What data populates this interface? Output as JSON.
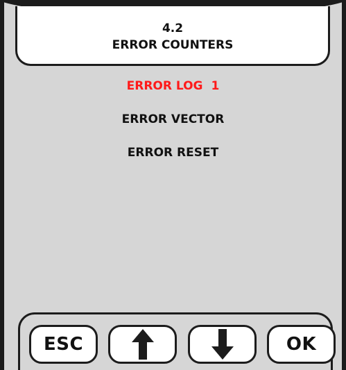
{
  "header": {
    "section_number": "4.2",
    "title": "ERROR COUNTERS"
  },
  "menu": {
    "items": [
      {
        "label": "ERROR LOG",
        "count": "1",
        "selected": true
      },
      {
        "label": "ERROR VECTOR",
        "count": "",
        "selected": false
      },
      {
        "label": "ERROR RESET",
        "count": "",
        "selected": false
      }
    ]
  },
  "keys": {
    "esc_label": "ESC",
    "up_icon": "arrow-up-icon",
    "down_icon": "arrow-down-icon",
    "ok_label": "OK"
  },
  "colors": {
    "screen_background": "#d6d6d6",
    "selected_item": "#ff1a1a",
    "frame": "#1c1c1c",
    "panel": "#ffffff"
  }
}
